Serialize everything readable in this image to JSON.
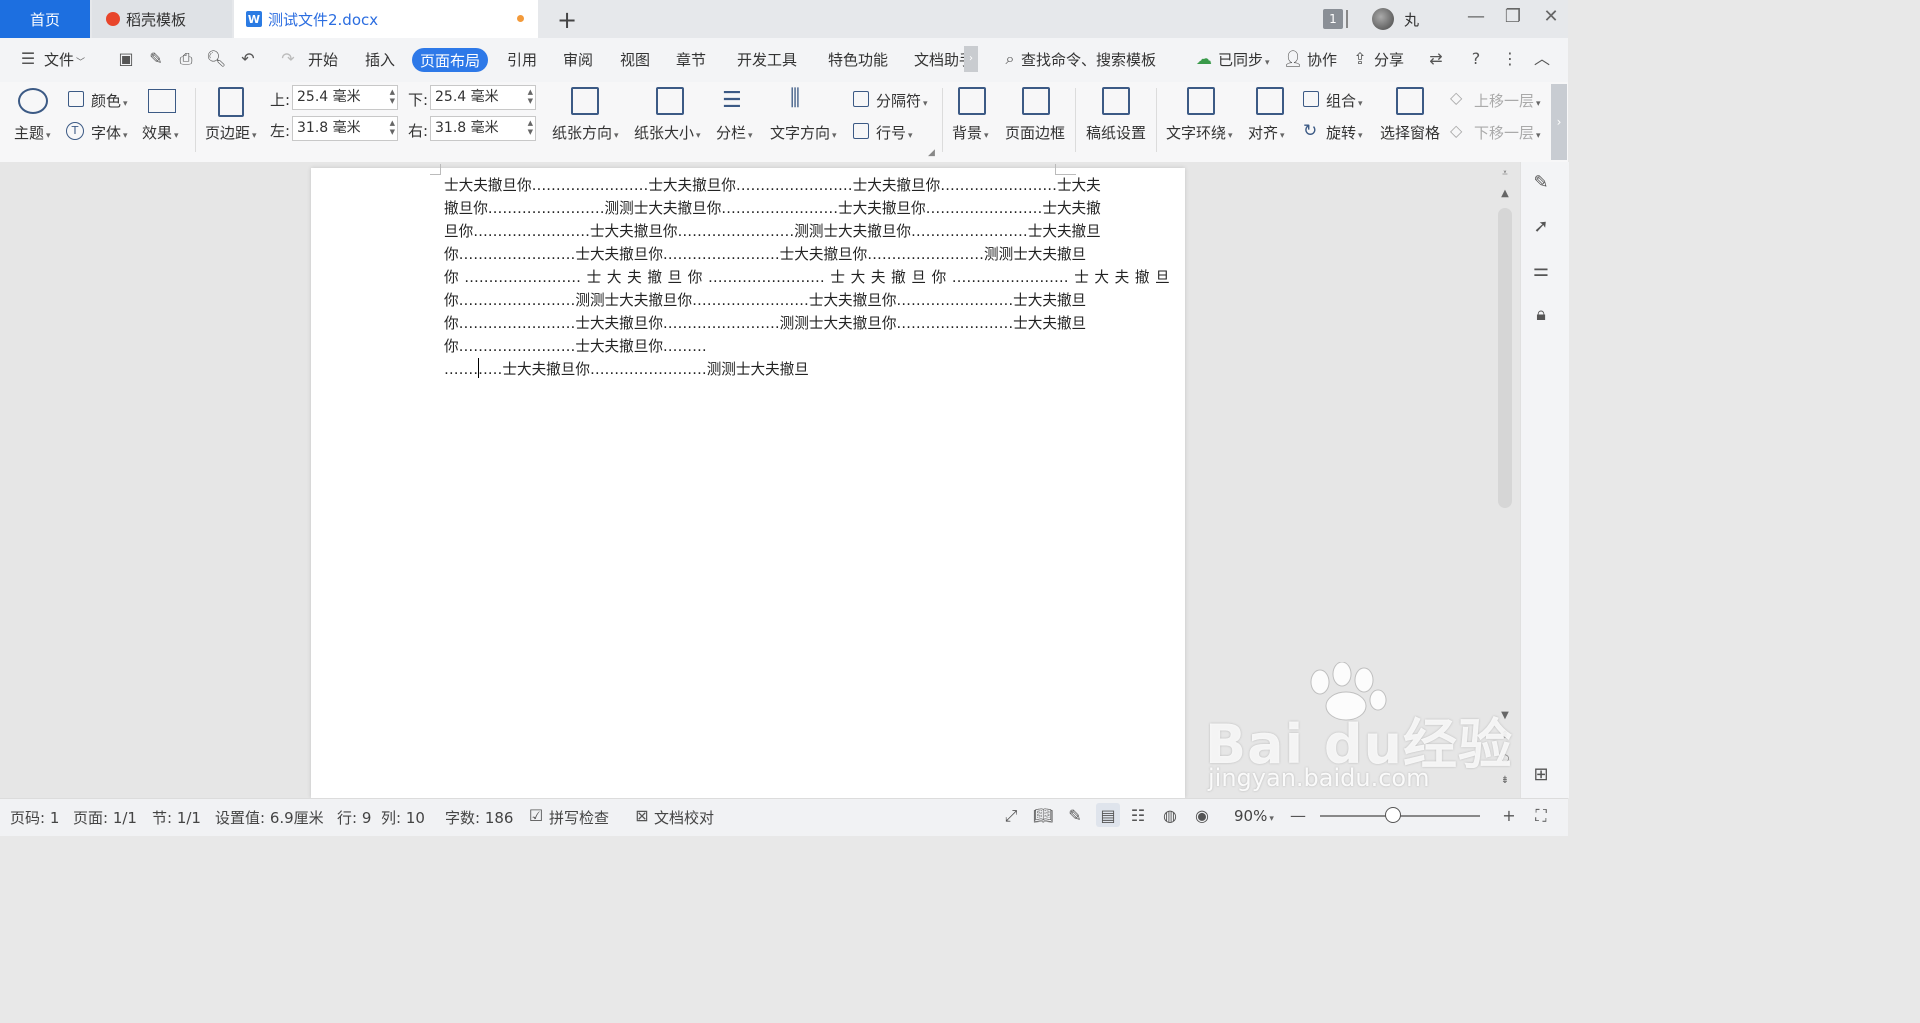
{
  "tabs": {
    "home": "首页",
    "template": "稻壳模板",
    "doc": "测试文件2.docx",
    "add": "+"
  },
  "window": {
    "badge": "1",
    "user": "丸",
    "min": "—",
    "restore": "❐",
    "close": "✕"
  },
  "menu": {
    "file": "文件",
    "items": [
      "开始",
      "插入",
      "页面布局",
      "引用",
      "审阅",
      "视图",
      "章节",
      "开发工具",
      "特色功能",
      "文档助手"
    ],
    "search": "查找命令、搜索模板",
    "synced": "已同步",
    "collab": "协作",
    "share": "分享"
  },
  "ribbon": {
    "theme": "主题",
    "color": "颜色",
    "font": "字体",
    "effect": "效果",
    "margin": "页边距",
    "top_label": "上:",
    "top_value": "25.4 毫米",
    "bottom_label": "下:",
    "bottom_value": "25.4 毫米",
    "left_label": "左:",
    "left_value": "31.8 毫米",
    "right_label": "右:",
    "right_value": "31.8 毫米",
    "orientation": "纸张方向",
    "size": "纸张大小",
    "columns": "分栏",
    "text_direction": "文字方向",
    "separator": "分隔符",
    "line_number": "行号",
    "background": "背景",
    "page_border": "页面边框",
    "manuscript": "稿纸设置",
    "wrap": "文字环绕",
    "align": "对齐",
    "group": "组合",
    "rotate": "旋转",
    "select_pane": "选择窗格",
    "bring_forward": "上移一层",
    "send_backward": "下移一层"
  },
  "document": {
    "lines": [
      "士大夫撤旦你……………………士大夫撤旦你……………………士大夫撤旦你……………………士大夫",
      "撤旦你……………………测测士大夫撤旦你……………………士大夫撤旦你……………………士大夫撤",
      "旦你……………………士大夫撤旦你……………………测测士大夫撤旦你……………………士大夫撤旦",
      "你……………………士大夫撤旦你……………………士大夫撤旦你……………………测测士大夫撤旦",
      "你 …………………… 士 大 夫 撤 旦 你 …………………… 士 大 夫 撤 旦 你 …………………… 士 大 夫 撤 旦",
      "你……………………测测士大夫撤旦你……………………士大夫撤旦你……………………士大夫撤旦",
      "你……………………士大夫撤旦你……………………测测士大夫撤旦你……………………士大夫撤旦",
      "你……………………士大夫撤旦你………",
      "…………士大夫撤旦你……………………测测士大夫撤旦"
    ]
  },
  "status": {
    "page_code": "页码: 1",
    "pages": "页面: 1/1",
    "section": "节: 1/1",
    "setting": "设置值: 6.9厘米",
    "row": "行: 9",
    "col": "列: 10",
    "words": "字数: 186",
    "spellcheck": "拼写检查",
    "proofread": "文档校对",
    "zoom": "90%"
  },
  "watermark": {
    "brand": "Bai du经验",
    "url": "jingyan.baidu.com"
  }
}
